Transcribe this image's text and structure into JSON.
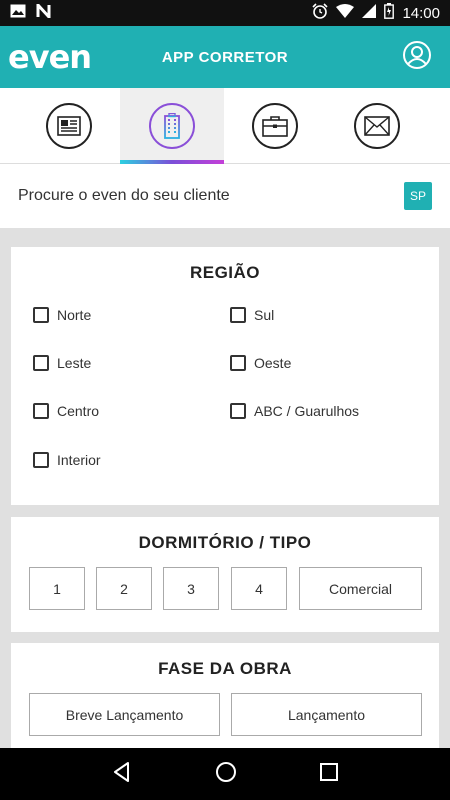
{
  "status_bar": {
    "time": "14:00",
    "left_icons": [
      "image-icon",
      "n-icon"
    ],
    "right_icons": [
      "alarm-icon",
      "wifi-icon",
      "signal-icon",
      "battery-icon"
    ]
  },
  "app_bar": {
    "logo": "even",
    "title": "APP CORRETOR",
    "profile_icon": "profile-icon",
    "color": "#20b0b3"
  },
  "tabs": [
    {
      "icon": "newspaper-icon",
      "active": false
    },
    {
      "icon": "building-icon",
      "active": true
    },
    {
      "icon": "briefcase-icon",
      "active": false
    },
    {
      "icon": "envelope-icon",
      "active": false
    }
  ],
  "search": {
    "label": "Procure o even do seu cliente",
    "state_button": "SP"
  },
  "regiao": {
    "title": "REGIÃO",
    "options": [
      {
        "label": "Norte",
        "checked": false
      },
      {
        "label": "Sul",
        "checked": false
      },
      {
        "label": "Leste",
        "checked": false
      },
      {
        "label": "Oeste",
        "checked": false
      },
      {
        "label": "Centro",
        "checked": false
      },
      {
        "label": "ABC / Guarulhos",
        "checked": false
      },
      {
        "label": "Interior",
        "checked": false
      }
    ]
  },
  "dormitorio": {
    "title": "DORMITÓRIO / TIPO",
    "options": [
      "1",
      "2",
      "3",
      "4",
      "Comercial"
    ]
  },
  "fase": {
    "title": "FASE DA OBRA",
    "options": [
      "Breve Lançamento",
      "Lançamento"
    ]
  },
  "nav_bar": {
    "icons": [
      "back-icon",
      "home-icon",
      "recents-icon"
    ]
  }
}
